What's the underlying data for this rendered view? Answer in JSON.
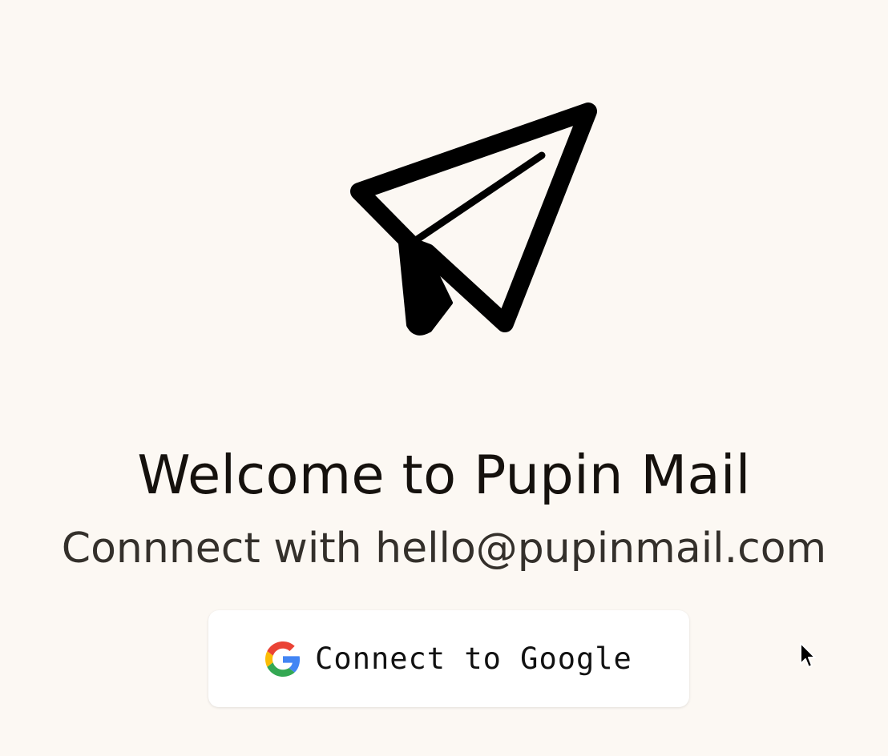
{
  "welcome": {
    "title": "Welcome to Pupin Mail",
    "subtitle": "Connnect with hello@pupinmail.com"
  },
  "connect_button": {
    "label": "Connect to Google",
    "icon": "google-icon"
  },
  "logo": {
    "icon": "paper-plane-icon"
  },
  "colors": {
    "background": "#fcf8f3",
    "button_background": "#ffffff",
    "text": "#15110d",
    "google_blue": "#4285F4",
    "google_red": "#EA4335",
    "google_yellow": "#FBBC05",
    "google_green": "#34A853"
  }
}
